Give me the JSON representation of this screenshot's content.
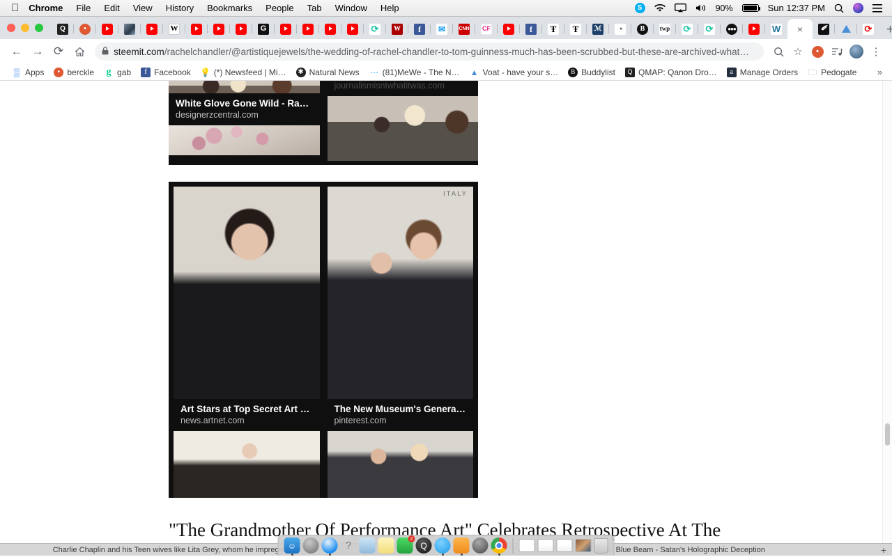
{
  "menubar": {
    "apple": "",
    "items": [
      {
        "label": "Chrome",
        "bold": true
      },
      {
        "label": "File",
        "bold": false
      },
      {
        "label": "Edit",
        "bold": false
      },
      {
        "label": "View",
        "bold": false
      },
      {
        "label": "History",
        "bold": false
      },
      {
        "label": "Bookmarks",
        "bold": false
      },
      {
        "label": "People",
        "bold": false
      },
      {
        "label": "Tab",
        "bold": false
      },
      {
        "label": "Window",
        "bold": false
      },
      {
        "label": "Help",
        "bold": false
      }
    ],
    "status": {
      "skype": "S",
      "wifi_icon": "wifi-icon",
      "airplay_icon": "airplay-icon",
      "volume_icon": "volume-icon",
      "battery_percent": "90%",
      "clock": "Sun 12:37 PM",
      "spotlight_icon": "search-icon",
      "siri_icon": "siri-icon",
      "notifications_icon": "list-icon"
    }
  },
  "tabstrip": {
    "tabs": [
      {
        "name": "tab-qmap",
        "icon": "Q",
        "cls": "qq",
        "active": false
      },
      {
        "name": "tab-duckduckgo",
        "icon": "•",
        "cls": "ddg",
        "active": false
      },
      {
        "name": "tab-youtube-1",
        "icon": "",
        "cls": "yt",
        "active": false
      },
      {
        "name": "tab-image",
        "icon": "",
        "cls": "img",
        "active": false
      },
      {
        "name": "tab-youtube-2",
        "icon": "",
        "cls": "yt",
        "active": false
      },
      {
        "name": "tab-wikipedia",
        "icon": "W",
        "cls": "wiki",
        "active": false
      },
      {
        "name": "tab-youtube-3",
        "icon": "",
        "cls": "yt",
        "active": false
      },
      {
        "name": "tab-youtube-4",
        "icon": "",
        "cls": "yt",
        "active": false
      },
      {
        "name": "tab-youtube-5",
        "icon": "",
        "cls": "yt",
        "active": false
      },
      {
        "name": "tab-gab",
        "icon": "G",
        "cls": "gab",
        "active": false
      },
      {
        "name": "tab-youtube-6",
        "icon": "",
        "cls": "yt",
        "active": false
      },
      {
        "name": "tab-youtube-7",
        "icon": "",
        "cls": "yt",
        "active": false
      },
      {
        "name": "tab-youtube-8",
        "icon": "",
        "cls": "yt",
        "active": false
      },
      {
        "name": "tab-youtube-9",
        "icon": "",
        "cls": "yt",
        "active": false
      },
      {
        "name": "tab-steemit-1",
        "icon": "⟳",
        "cls": "sp",
        "active": false
      },
      {
        "name": "tab-wsj",
        "icon": "W",
        "cls": "wsj",
        "active": false
      },
      {
        "name": "tab-facebook-1",
        "icon": "f",
        "cls": "fb",
        "active": false
      },
      {
        "name": "tab-twitter",
        "icon": "✉",
        "cls": "tw",
        "active": false
      },
      {
        "name": "tab-cnn",
        "icon": "CNN",
        "cls": "cnn",
        "active": false
      },
      {
        "name": "tab-cf",
        "icon": "CF",
        "cls": "cf",
        "active": false
      },
      {
        "name": "tab-youtube-10",
        "icon": "",
        "cls": "yt",
        "active": false
      },
      {
        "name": "tab-facebook-2",
        "icon": "f",
        "cls": "fb",
        "active": false
      },
      {
        "name": "tab-nytimes-1",
        "icon": "Ŧ",
        "cls": "nyt",
        "active": false
      },
      {
        "name": "tab-nytimes-2",
        "icon": "Ŧ",
        "cls": "nyt",
        "active": false
      },
      {
        "name": "tab-newspaper",
        "icon": "ℳ",
        "cls": "mn",
        "active": false
      },
      {
        "name": "tab-globe",
        "icon": "◔",
        "cls": "glb",
        "active": false
      },
      {
        "name": "tab-bitchute",
        "icon": "B",
        "cls": "bc",
        "active": false
      },
      {
        "name": "tab-washington-post",
        "icon": "twp",
        "cls": "twp",
        "active": false
      },
      {
        "name": "tab-steemit-2",
        "icon": "⟳",
        "cls": "sp",
        "active": false
      },
      {
        "name": "tab-steemit-3",
        "icon": "⟳",
        "cls": "sp",
        "active": false
      },
      {
        "name": "tab-masked",
        "icon": "●●●",
        "cls": "mask",
        "active": false
      },
      {
        "name": "tab-youtube-11",
        "icon": "",
        "cls": "yt",
        "active": false
      },
      {
        "name": "tab-wordpress",
        "icon": "W",
        "cls": "wp",
        "active": false
      },
      {
        "name": "tab-active-steemit",
        "icon": "×",
        "cls": "close",
        "active": true
      },
      {
        "name": "tab-pv",
        "icon": "✐",
        "cls": "pv",
        "active": false
      },
      {
        "name": "tab-voat",
        "icon": "▲",
        "cls": "tri",
        "active": false
      },
      {
        "name": "tab-reload-site",
        "icon": "⟳",
        "cls": "cc",
        "active": false
      }
    ],
    "new_tab_label": "+"
  },
  "toolbar": {
    "back_icon": "←",
    "forward_icon": "→",
    "reload_icon": "⟳",
    "home_icon": "⌂",
    "lock_icon": "🔒",
    "url_host": "steemit.com",
    "url_path": "/rachelchandler/@artistiquejewels/the-wedding-of-rachel-chandler-to-tom-guinness-much-has-been-scrubbed-but-these-are-archived-what…",
    "zoom_icon": "⊕",
    "bookmark_star_icon": "☆",
    "extension_ddg_icon": "duckduckgo-icon",
    "media_icon": "♫",
    "profile_icon": "avatar",
    "menu_icon": "⋮"
  },
  "bookmarks": {
    "items": [
      {
        "label": "Apps",
        "icon": "▒",
        "cls": "bi-apps"
      },
      {
        "label": "berckle",
        "icon": "•",
        "cls": "bi-ddg"
      },
      {
        "label": "gab",
        "icon": "g",
        "cls": "bi-gab"
      },
      {
        "label": "Facebook",
        "icon": "f",
        "cls": "bi-fb"
      },
      {
        "label": "(*) Newsfeed | Mi…",
        "icon": "💡",
        "cls": "bi-bulb"
      },
      {
        "label": "Natural News",
        "icon": "✱",
        "cls": "bi-nn"
      },
      {
        "label": "(81)MeWe - The N…",
        "icon": "⋯",
        "cls": "bi-mewe"
      },
      {
        "label": "Voat - have your s…",
        "icon": "▲",
        "cls": "bi-voat"
      },
      {
        "label": "Buddylist",
        "icon": "B",
        "cls": "bi-bud"
      },
      {
        "label": "QMAP: Qanon Dro…",
        "icon": "Q",
        "cls": "bi-qmap"
      },
      {
        "label": "Manage Orders",
        "icon": "a",
        "cls": "bi-amz"
      },
      {
        "label": "Pedogate",
        "icon": "🗀",
        "cls": "bi-folder"
      }
    ],
    "overflow_label": "»"
  },
  "page": {
    "top_card": {
      "title": "White Glove Gone Wild - Rachel…",
      "domain": "designerzcentral.com",
      "faded_domain": "journalismisntwhatitwas.com"
    },
    "main_card": {
      "left": {
        "title": "Art Stars at Top Secret Art Pro…",
        "domain": "news.artnet.com"
      },
      "right": {
        "title": "The New Museum's Generation …",
        "domain": "pinterest.com",
        "photo_tag": "ITALY"
      }
    },
    "headline": "\"The Grandmother Of Performance Art\" Celebrates Retrospective At The"
  },
  "dock": {
    "items": [
      {
        "name": "dock-finder",
        "label": "Finder",
        "cls": "dk-finder",
        "running": true,
        "glyph": "☺"
      },
      {
        "name": "dock-launchpad",
        "label": "Launchpad",
        "cls": "dk-launch",
        "running": false,
        "glyph": "🚀"
      },
      {
        "name": "dock-safari",
        "label": "Safari",
        "cls": "dk-safari",
        "running": true,
        "glyph": "⌖"
      },
      {
        "name": "dock-question",
        "label": "?",
        "cls": "dk-q",
        "running": false,
        "glyph": "?"
      },
      {
        "name": "dock-preview",
        "label": "Preview",
        "cls": "dk-preview",
        "running": false,
        "glyph": "🖼"
      },
      {
        "name": "dock-notes",
        "label": "Notes",
        "cls": "dk-notes",
        "running": false,
        "glyph": ""
      },
      {
        "name": "dock-facetime",
        "label": "FaceTime",
        "cls": "dk-facetime",
        "running": false,
        "glyph": "✆"
      },
      {
        "name": "dock-quicktime",
        "label": "QuickTime Player",
        "cls": "dk-qt",
        "running": false,
        "glyph": "Q"
      },
      {
        "name": "dock-messages",
        "label": "Messages",
        "cls": "dk-msg",
        "running": true,
        "glyph": "💬"
      },
      {
        "name": "dock-pages",
        "label": "Pages",
        "cls": "dk-pages",
        "running": true,
        "glyph": "📝"
      },
      {
        "name": "dock-system-preferences",
        "label": "System Preferences",
        "cls": "dk-prefs",
        "running": false,
        "glyph": "⚙"
      },
      {
        "name": "dock-chrome",
        "label": "Google Chrome",
        "cls": "dk-chrome",
        "running": true,
        "glyph": ""
      }
    ],
    "facetime_badge": "2",
    "trash_label": "Trash"
  },
  "taskbar": {
    "window_1": "Charlie Chaplin and his Teen wives like Lita Grey, whom he impregnate",
    "window_2": "ct Blue Beam - Satan's Holographic Deception",
    "add_label": "+"
  },
  "colors": {
    "chrome_tabstrip": "#dee1e6",
    "omnibox": "#f1f3f4",
    "card_bg": "#0f0f0f",
    "accent_blue": "#4285f4"
  }
}
